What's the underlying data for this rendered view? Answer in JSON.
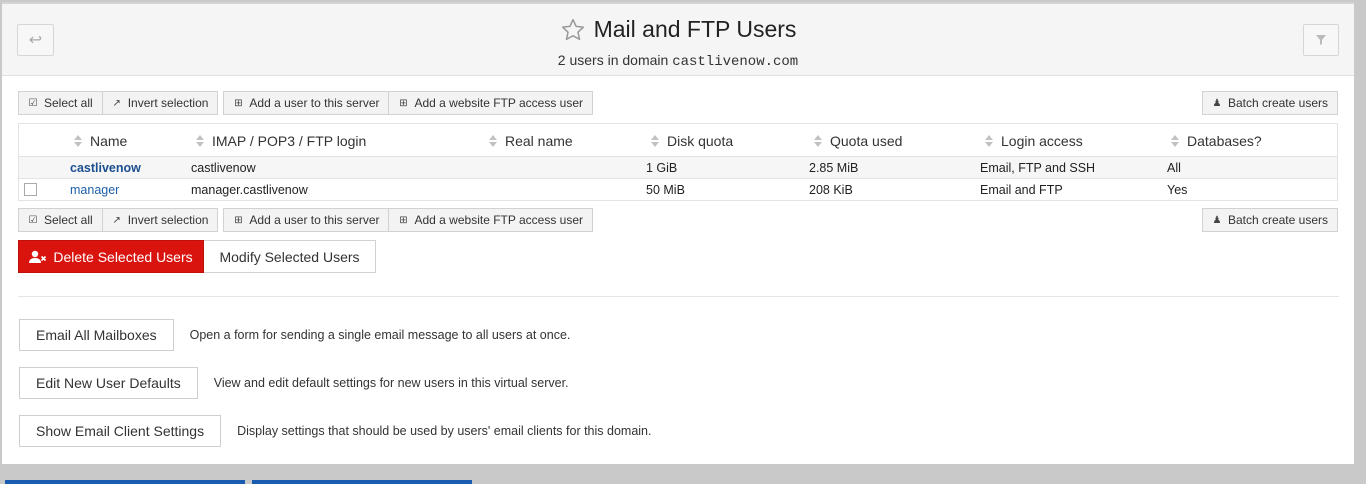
{
  "header": {
    "title": "Mail and FTP Users",
    "subtitle_prefix": "2 users in domain ",
    "domain": "castlivenow.com",
    "back_icon": "back-arrow-icon",
    "filter_icon": "filter-icon",
    "star_icon": "star-icon"
  },
  "toolbar": {
    "select_all": "Select all",
    "invert_selection": "Invert selection",
    "add_user": "Add a user to this server",
    "add_ftp_user": "Add a website FTP access user",
    "batch_create": "Batch create users"
  },
  "table": {
    "columns": [
      "Name",
      "IMAP / POP3 / FTP login",
      "Real name",
      "Disk quota",
      "Quota used",
      "Login access",
      "Databases?"
    ],
    "rows": [
      {
        "name": "castlivenow",
        "login": "castlivenow",
        "real_name": "",
        "disk_quota": "1 GiB",
        "quota_used": "2.85 MiB",
        "login_access": "Email, FTP and SSH",
        "databases": "All"
      },
      {
        "name": "manager",
        "login": "manager.castlivenow",
        "real_name": "",
        "disk_quota": "50 MiB",
        "quota_used": "208 KiB",
        "login_access": "Email and FTP",
        "databases": "Yes"
      }
    ]
  },
  "actions": {
    "delete": "Delete Selected Users",
    "modify": "Modify Selected Users"
  },
  "options": [
    {
      "label": "Email All Mailboxes",
      "desc": "Open a form for sending a single email message to all users at once."
    },
    {
      "label": "Edit New User Defaults",
      "desc": "View and edit default settings for new users in this virtual server."
    },
    {
      "label": "Show Email Client Settings",
      "desc": "Display settings that should be used by users' email clients for this domain."
    }
  ],
  "colors": {
    "danger": "#d9140f",
    "link": "#1f5fa8",
    "tab": "#1a5db0"
  }
}
